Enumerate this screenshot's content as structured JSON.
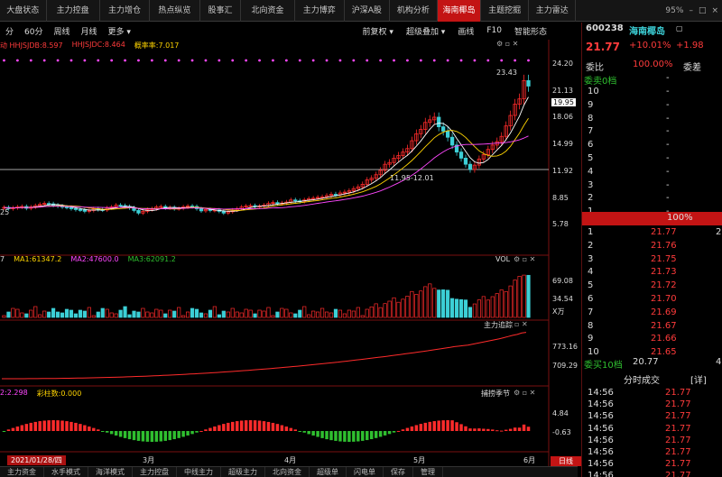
{
  "tabs": [
    "大盘状态",
    "主力控盘",
    "主力增仓",
    "热点纵览",
    "股事汇",
    "北向资金",
    "主力博弈",
    "沪深A股",
    "机构分析",
    "海南椰岛",
    "主题挖掘",
    "主力雷达"
  ],
  "active_tab": 9,
  "window": {
    "zoom": "95%",
    "controls": [
      "–",
      "□",
      "×"
    ]
  },
  "toolbar": {
    "periods": [
      "分",
      "60分",
      "周线",
      "月线",
      "更多 ▾"
    ],
    "right": [
      "前复权 ▾",
      "超级叠加 ▾",
      "画线",
      "F10",
      "智能形态"
    ]
  },
  "indicators": {
    "main": [
      {
        "text": "动 HHJSJDB:8.597",
        "color": "#ff3b3b"
      },
      {
        "text": "HHJSJDC:8.464",
        "color": "#ff3b3b"
      },
      {
        "text": "概率率:7.017",
        "color": "#ffd400"
      }
    ],
    "vol": [
      {
        "text": "7",
        "color": "#ddd"
      },
      {
        "text": "MA1:61347.2",
        "color": "#ffd400"
      },
      {
        "text": "MA2:47600.0",
        "color": "#ff47ff"
      },
      {
        "text": "MA3:62091.2",
        "color": "#2fbf2f"
      }
    ],
    "macd": [
      {
        "text": "2:2.298",
        "color": "#ff47ff"
      },
      {
        "text": "彩柱数:0.000",
        "color": "#ffd400"
      }
    ]
  },
  "panel_titles": {
    "vol": "VOL",
    "trace": "主力追踪",
    "capture": "捕捞季节"
  },
  "axis": {
    "main": [
      {
        "v": "24.20",
        "y": 72
      },
      {
        "v": "21.13",
        "y": 102
      },
      {
        "v": "18.06",
        "y": 131
      },
      {
        "v": "14.99",
        "y": 161
      },
      {
        "v": "11.92",
        "y": 191
      },
      {
        "v": "8.85",
        "y": 221
      },
      {
        "v": "5.78",
        "y": 250
      }
    ],
    "vol": [
      {
        "v": "69.08",
        "y": 313
      },
      {
        "v": "34.54",
        "y": 333
      },
      {
        "v": "X万",
        "y": 346
      }
    ],
    "trace": [
      {
        "v": "773.16",
        "y": 386
      },
      {
        "v": "709.29",
        "y": 407
      }
    ],
    "capture": [
      {
        "v": "4.84",
        "y": 460
      },
      {
        "v": "-0.63",
        "y": 481
      }
    ]
  },
  "annotations": {
    "high": "23.43",
    "low_range": "11.95-12.01",
    "left_low": "25",
    "price_tag": "19.95"
  },
  "dates": [
    "2021/01/28/四",
    "3月",
    "4月",
    "5月",
    "6月"
  ],
  "chart_data": {
    "type": "candlestick",
    "closes": [
      7.85,
      7.7,
      7.8,
      7.9,
      7.95,
      7.75,
      7.9,
      8.05,
      8.2,
      8.3,
      8.25,
      8.1,
      8.0,
      7.9,
      7.85,
      7.7,
      7.6,
      7.55,
      7.4,
      7.5,
      7.7,
      7.6,
      7.55,
      7.8,
      7.9,
      8.1,
      8.05,
      7.95,
      7.8,
      7.5,
      7.2,
      7.4,
      7.6,
      7.7,
      7.9,
      7.95,
      7.8,
      7.85,
      7.7,
      7.75,
      7.9,
      8.0,
      7.95,
      7.7,
      7.45,
      7.6,
      7.5,
      7.55,
      7.4,
      7.2,
      7.35,
      7.55,
      7.7,
      7.9,
      8.0,
      8.05,
      7.95,
      8.0,
      8.1,
      8.3,
      8.4,
      8.3,
      8.35,
      8.45,
      8.7,
      8.6,
      8.55,
      8.7,
      8.85,
      8.9,
      9.0,
      9.05,
      9.2,
      9.35,
      9.3,
      9.5,
      9.6,
      9.75,
      10.0,
      10.2,
      10.5,
      11.0,
      11.2,
      11.6,
      12.1,
      12.8,
      13.0,
      13.5,
      13.8,
      14.2,
      14.6,
      15.5,
      16.3,
      16.8,
      17.6,
      17.9,
      18.2,
      17.1,
      16.6,
      15.9,
      15.0,
      14.2,
      13.5,
      12.8,
      12.2,
      12.7,
      13.4,
      13.9,
      14.5,
      15.0,
      15.4,
      16.0,
      17.2,
      18.4,
      19.7,
      20.3,
      22.4,
      21.77
    ],
    "ylim": [
      5.78,
      24.2
    ],
    "volume_ma": {
      "MA1": 61347.2,
      "MA2": 47600.0,
      "MA3": 62091.2
    },
    "stock": {
      "code": "600238",
      "name": "海南椰岛"
    }
  },
  "quote": {
    "code": "600238",
    "name": "海南椰岛",
    "price": "21.77",
    "pct": "+10.01%",
    "chg": "+1.98",
    "ratio_label": "委比",
    "ratio_val": "100.00%",
    "diff_label": "委差",
    "sell_header": "委卖0档",
    "sell_header_val": "-",
    "sell": [
      {
        "lv": "10",
        "p": "-"
      },
      {
        "lv": "9",
        "p": "-"
      },
      {
        "lv": "8",
        "p": "-"
      },
      {
        "lv": "7",
        "p": "-"
      },
      {
        "lv": "6",
        "p": "-"
      },
      {
        "lv": "5",
        "p": "-"
      },
      {
        "lv": "4",
        "p": "-"
      },
      {
        "lv": "3",
        "p": "-"
      },
      {
        "lv": "2",
        "p": "-"
      },
      {
        "lv": "1",
        "p": "-"
      }
    ],
    "bar_val": "100%",
    "buy": [
      {
        "lv": "1",
        "p": "21.77",
        "v": "2"
      },
      {
        "lv": "2",
        "p": "21.76",
        "v": ""
      },
      {
        "lv": "3",
        "p": "21.75",
        "v": ""
      },
      {
        "lv": "4",
        "p": "21.73",
        "v": ""
      },
      {
        "lv": "5",
        "p": "21.72",
        "v": ""
      },
      {
        "lv": "6",
        "p": "21.70",
        "v": ""
      },
      {
        "lv": "7",
        "p": "21.69",
        "v": ""
      },
      {
        "lv": "8",
        "p": "21.67",
        "v": ""
      },
      {
        "lv": "9",
        "p": "21.66",
        "v": ""
      },
      {
        "lv": "10",
        "p": "21.65",
        "v": ""
      }
    ],
    "buy_footer": "委买10档",
    "buy_footer_val": "20.77",
    "buy_footer_v2": "4",
    "trades_title": "分时成交",
    "trades_btn": "[详]",
    "trades": [
      {
        "t": "14:56",
        "p": "21.77"
      },
      {
        "t": "14:56",
        "p": "21.77"
      },
      {
        "t": "14:56",
        "p": "21.77"
      },
      {
        "t": "14:56",
        "p": "21.77"
      },
      {
        "t": "14:56",
        "p": "21.77"
      },
      {
        "t": "14:56",
        "p": "21.77"
      },
      {
        "t": "14:56",
        "p": "21.77"
      },
      {
        "t": "14:56",
        "p": "21.77"
      },
      {
        "t": "15:00",
        "p": "21.77"
      }
    ]
  },
  "bottom_tabs": [
    "主力资金",
    "水手模式",
    "海洋模式",
    "主力控盘",
    "中线主力",
    "超级主力",
    "北向资金",
    "超级单",
    "闪电单",
    "保存",
    "管理"
  ],
  "bottom_right": "日线"
}
